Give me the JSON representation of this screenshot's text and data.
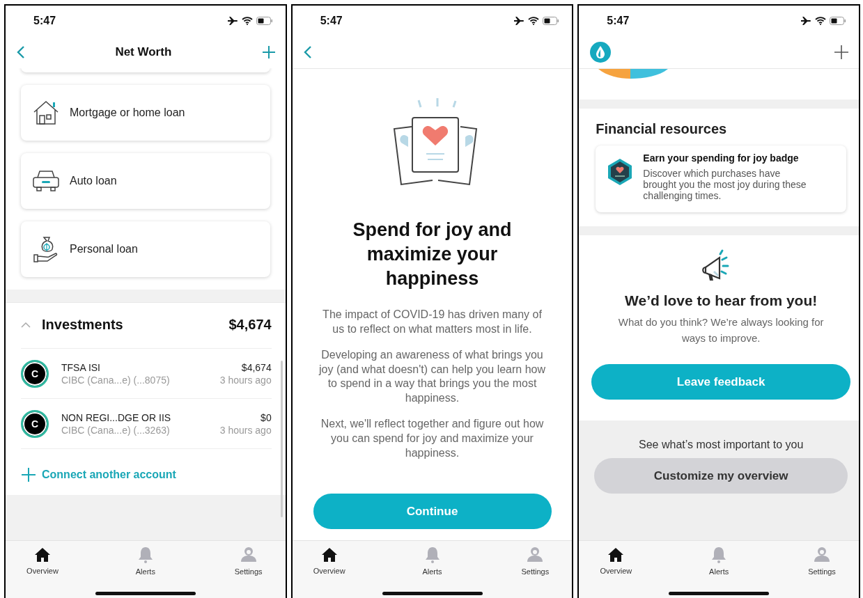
{
  "screens": [
    {
      "kind": "net_worth",
      "time": "5:47",
      "nav": {
        "title": "Net Worth"
      },
      "loan_options": [
        {
          "label": "Mortgage or home loan"
        },
        {
          "label": "Auto loan"
        },
        {
          "label": "Personal loan"
        }
      ],
      "investments": {
        "title": "Investments",
        "total": "$4,674",
        "expanded": true,
        "accounts": [
          {
            "initial": "C",
            "name": "TFSA ISI",
            "institution": "CIBC (Cana...e) (...8075)",
            "balance": "$4,674",
            "updated": "3 hours ago"
          },
          {
            "initial": "C",
            "name": "NON REGI...DGE OR IIS",
            "institution": "CIBC (Cana...e) (...3263)",
            "balance": "$0",
            "updated": "3 hours ago"
          }
        ]
      },
      "connect_link": "Connect another account",
      "tabs": [
        {
          "label": "Overview",
          "selected": true
        },
        {
          "label": "Alerts",
          "selected": false
        },
        {
          "label": "Settings",
          "selected": false
        }
      ]
    },
    {
      "kind": "intro",
      "time": "5:47",
      "title": "Spend for joy and maximize your happiness",
      "paragraphs": [
        "The impact of COVID-19 has driven many of us to reflect on what matters most in life.",
        "Developing an awareness of what brings you joy (and what doesn't) can help you learn how to spend in a way that brings you the most happiness.",
        "Next, we'll reflect together and figure out how you can spend for joy and maximize your happiness."
      ],
      "button": "Continue",
      "tabs": [
        {
          "label": "Overview",
          "selected": true
        },
        {
          "label": "Alerts",
          "selected": false
        },
        {
          "label": "Settings",
          "selected": false
        }
      ]
    },
    {
      "kind": "overview",
      "time": "5:47",
      "resources": {
        "heading": "Financial resources",
        "card_title": "Earn your spending for joy badge",
        "card_text": "Discover which purchases have brought you the most joy during these challenging times."
      },
      "feedback": {
        "title": "We’d love to hear from you!",
        "text": "What do you think? We’re always looking for ways to improve.",
        "button": "Leave feedback"
      },
      "customize": {
        "text": "See what’s most important to you",
        "button": "Customize my overview"
      },
      "tabs": [
        {
          "label": "Overview",
          "selected": true
        },
        {
          "label": "Alerts",
          "selected": false
        },
        {
          "label": "Settings",
          "selected": false
        }
      ]
    }
  ]
}
